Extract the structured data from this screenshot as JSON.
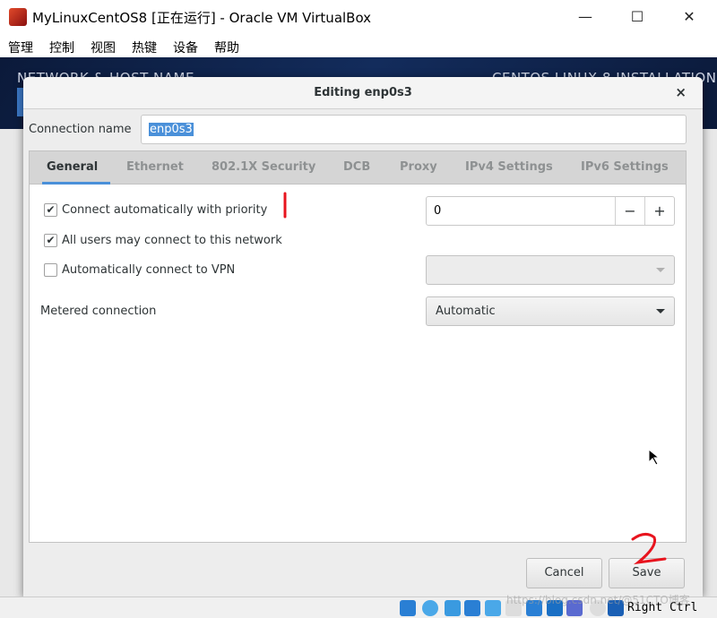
{
  "window": {
    "title": "MyLinuxCentOS8 [正在运行] - Oracle VM VirtualBox",
    "minimize": "—",
    "maximize": "☐",
    "close": "✕"
  },
  "menu": [
    "管理",
    "控制",
    "视图",
    "热键",
    "设备",
    "帮助"
  ],
  "installer": {
    "left_header": "NETWORK & HOST NAME",
    "right_header": "CENTOS LINUX 8 INSTALLATION",
    "side_digit": "8"
  },
  "dialog": {
    "title": "Editing enp0s3",
    "close": "×",
    "connection_name_label": "Connection name",
    "connection_name_value": "enp0s3",
    "tabs": [
      "General",
      "Ethernet",
      "802.1X Security",
      "DCB",
      "Proxy",
      "IPv4 Settings",
      "IPv6 Settings"
    ],
    "active_tab": "General",
    "general": {
      "auto_connect": {
        "label": "Connect automatically with priority",
        "checked": true
      },
      "priority": "0",
      "minus": "−",
      "plus": "+",
      "all_users": {
        "label": "All users may connect to this network",
        "checked": true
      },
      "auto_vpn": {
        "label": "Automatically connect to VPN",
        "checked": false
      },
      "vpn_value": "",
      "metered_label": "Metered connection",
      "metered_value": "Automatic"
    },
    "cancel": "Cancel",
    "save": "Save"
  },
  "annotations": {
    "one": "1",
    "two": "2"
  },
  "statusbar": {
    "host_key": "Right Ctrl",
    "watermark": "https://blog.csdn.net/@51CTO博客"
  },
  "colors": {
    "accent": "#4a90d9",
    "annotation": "#e8141e"
  }
}
